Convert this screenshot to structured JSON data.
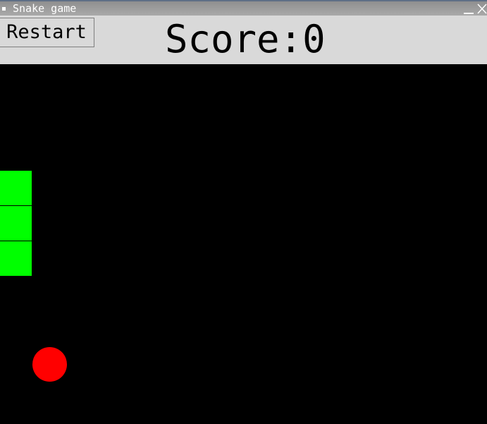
{
  "window": {
    "title": "Snake game"
  },
  "toolbar": {
    "restart_label": "Restart",
    "score_text": "Score:0"
  },
  "game": {
    "score": 0,
    "snake_color": "#00ff00",
    "food_color": "#ff0000",
    "background_color": "#000000",
    "snake_segments": 3
  }
}
